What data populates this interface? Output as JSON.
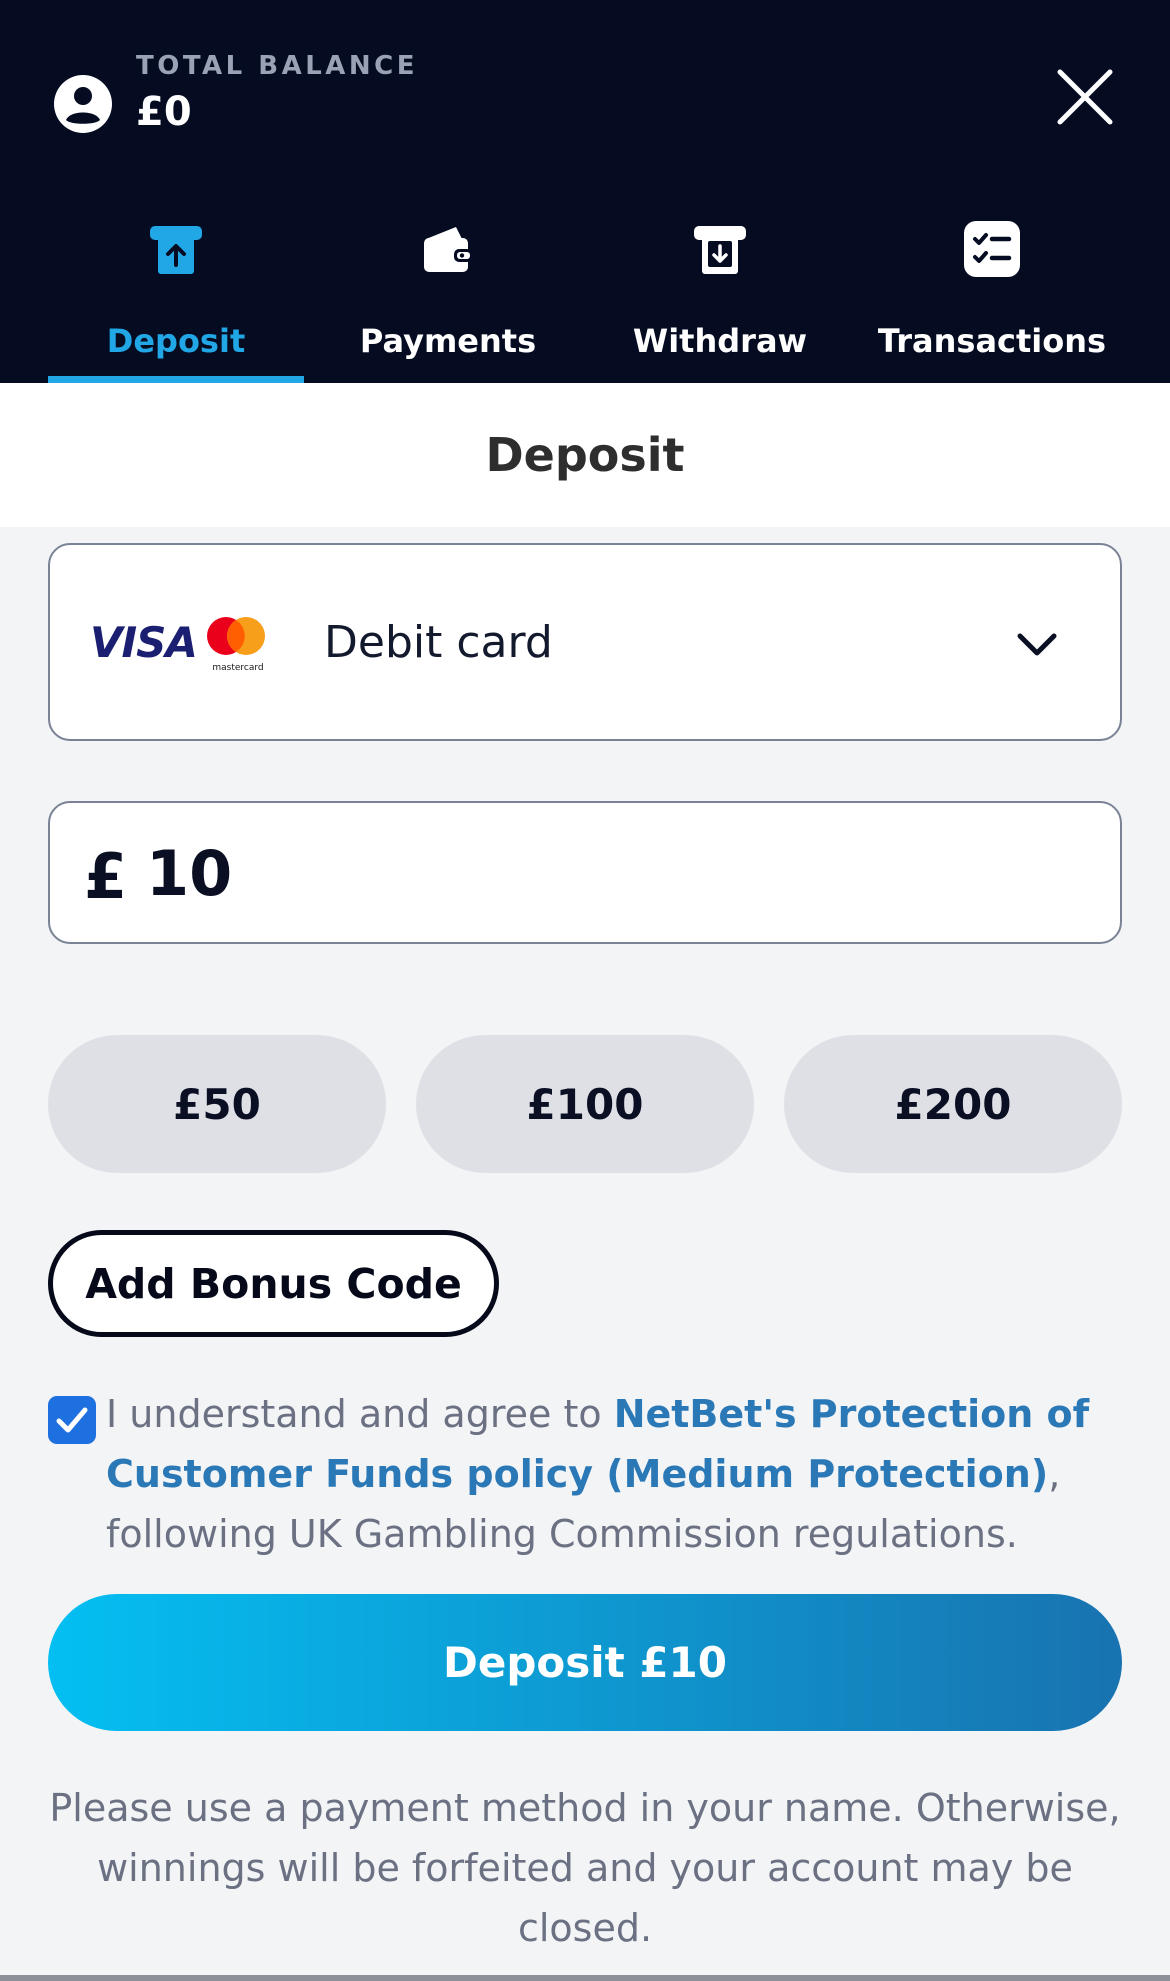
{
  "header": {
    "balance_label": "TOTAL BALANCE",
    "balance_value": "£0"
  },
  "tabs": [
    {
      "label": "Deposit",
      "icon": "atm-deposit-icon",
      "active": true
    },
    {
      "label": "Payments",
      "icon": "wallet-icon",
      "active": false
    },
    {
      "label": "Withdraw",
      "icon": "atm-withdraw-icon",
      "active": false
    },
    {
      "label": "Transactions",
      "icon": "checklist-icon",
      "active": false
    }
  ],
  "page": {
    "title": "Deposit"
  },
  "payment_method": {
    "brand_visa": "VISA",
    "brand_mastercard": "mastercard",
    "selected": "Debit card"
  },
  "amount": {
    "currency": "£",
    "value": "10"
  },
  "quick_amounts": [
    "£50",
    "£100",
    "£200"
  ],
  "bonus": {
    "button_label": "Add Bonus Code"
  },
  "agreement": {
    "checked": true,
    "text_before": "I understand and agree to ",
    "link_text": "NetBet's Protection of Customer Funds policy (Medium Protection)",
    "text_after": ", following UK Gambling Commission regulations."
  },
  "submit": {
    "label": "Deposit £10"
  },
  "notice": "Please use a payment method in your name. Otherwise, winnings will be forfeited and your account may be closed.",
  "colors": {
    "header_bg": "#050c22",
    "accent": "#21a6e6",
    "link": "#2b78b7",
    "checkbox": "#1e6fe0",
    "button_gradient_start": "#04bff2",
    "button_gradient_end": "#1873b0"
  }
}
